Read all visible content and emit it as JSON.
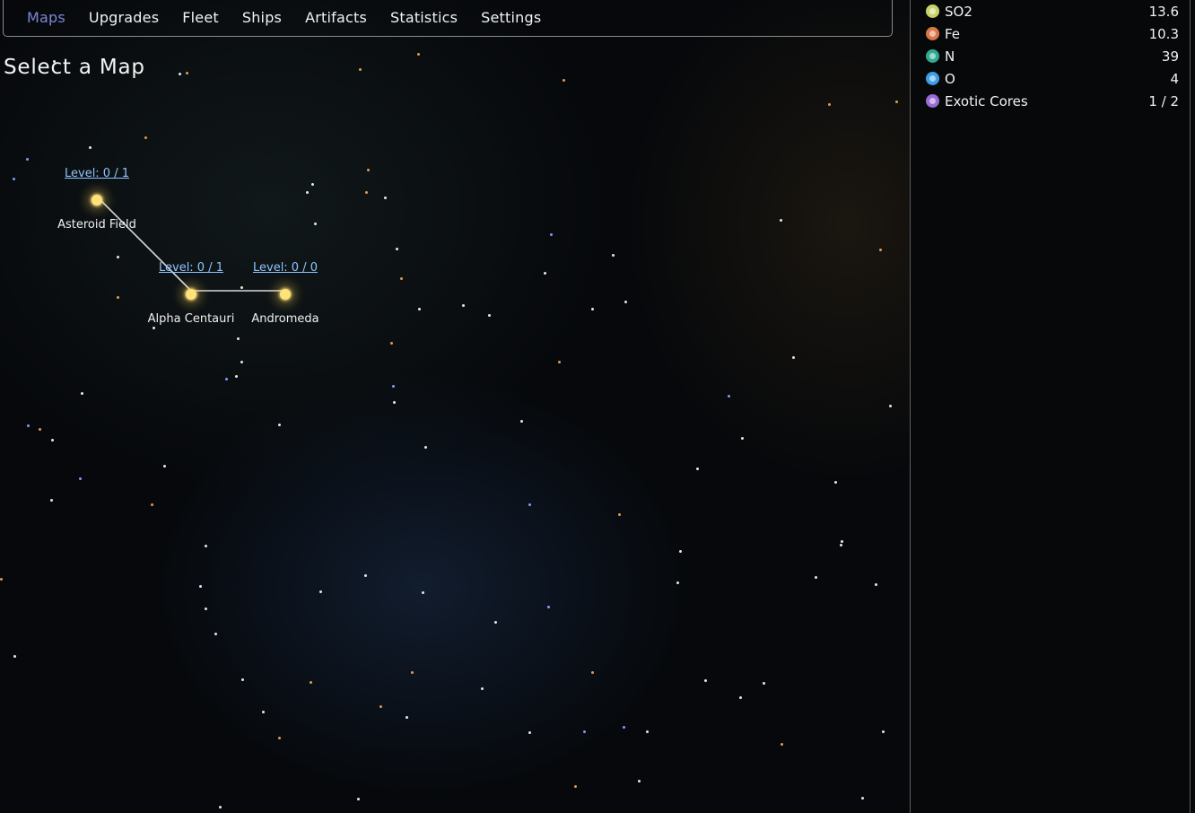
{
  "nav": {
    "items": [
      {
        "label": "Maps",
        "active": true
      },
      {
        "label": "Upgrades"
      },
      {
        "label": "Fleet"
      },
      {
        "label": "Ships"
      },
      {
        "label": "Artifacts"
      },
      {
        "label": "Statistics"
      },
      {
        "label": "Settings"
      }
    ]
  },
  "page": {
    "title": "Select a Map"
  },
  "maps": [
    {
      "name": "Asteroid Field",
      "level": "Level: 0 / 1"
    },
    {
      "name": "Alpha Centauri",
      "level": "Level: 0 / 1"
    },
    {
      "name": "Andromeda",
      "level": "Level: 0 / 0"
    }
  ],
  "resources": [
    {
      "name": "SO2",
      "value": "13.6",
      "color": "#c9d26a"
    },
    {
      "name": "Fe",
      "value": "10.3",
      "color": "#d9774a"
    },
    {
      "name": "N",
      "value": "39",
      "color": "#2fa991"
    },
    {
      "name": "O",
      "value": "4",
      "color": "#3e9ee6"
    },
    {
      "name": "Exotic Cores",
      "value": "1 / 2",
      "color": "#9a6ad6"
    }
  ]
}
